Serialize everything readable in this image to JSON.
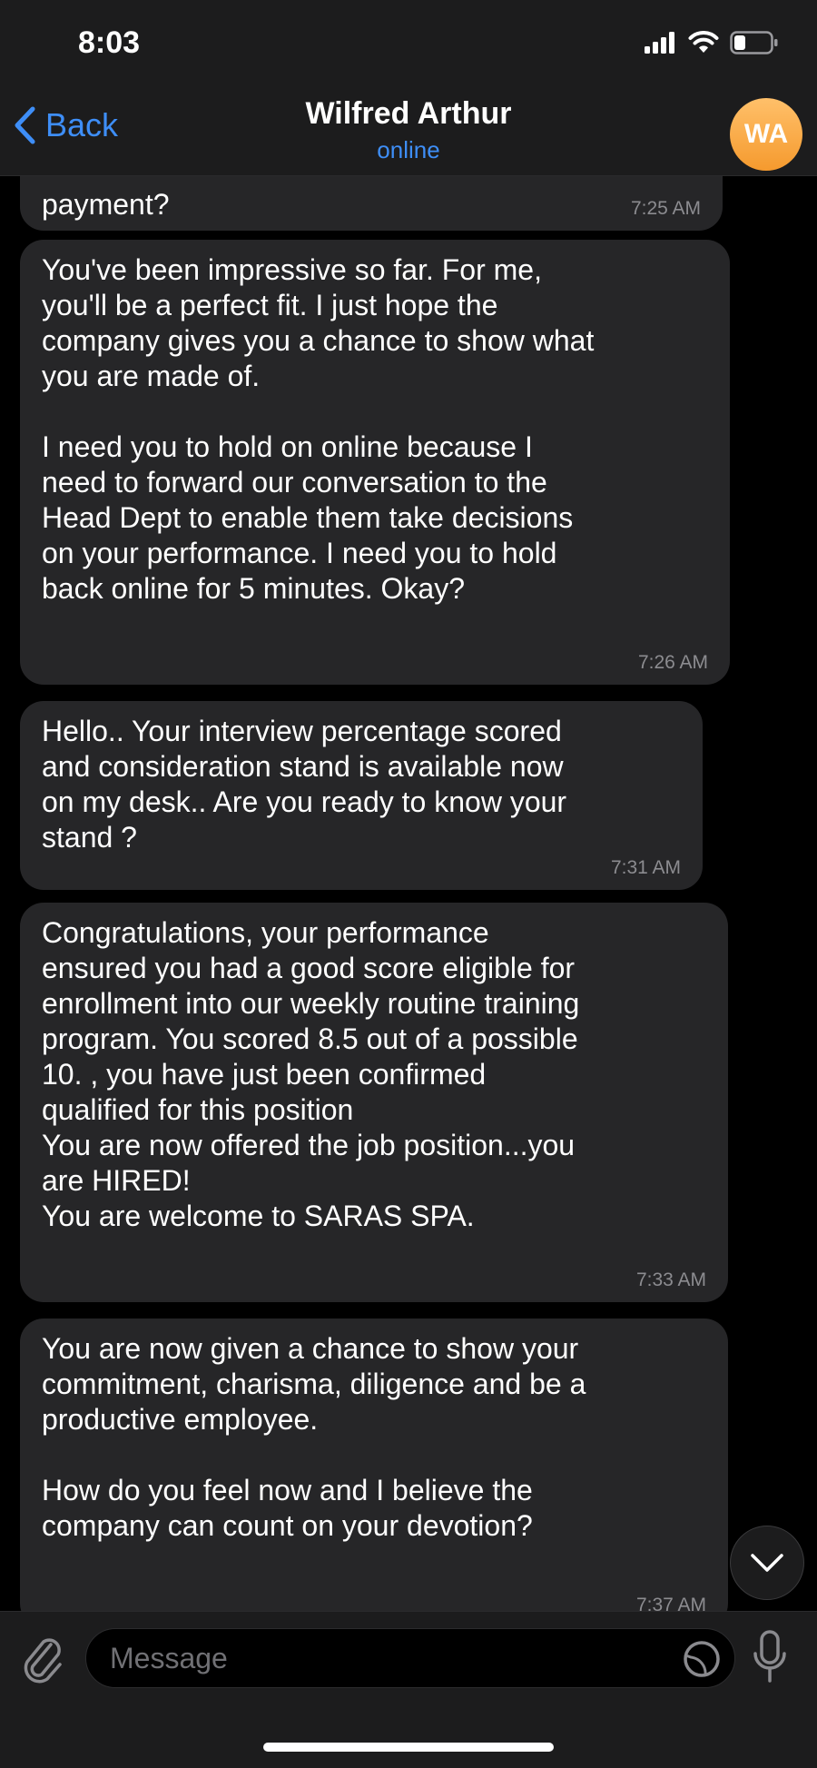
{
  "status": {
    "time": "8:03"
  },
  "header": {
    "back_label": "Back",
    "contact_name": "Wilfred Arthur",
    "contact_status": "online",
    "avatar_initials": "WA"
  },
  "messages": [
    {
      "text": "payment?",
      "time": "7:25 AM"
    },
    {
      "text": "You've been impressive so far. For me,\nyou'll be a perfect fit. I just hope the\ncompany gives you a chance to show what\nyou are made of.\n\nI need you to hold on online because I\nneed to forward our conversation to the\nHead Dept to enable them take decisions\non your performance. I need you to hold\nback online for 5 minutes. Okay?",
      "time": "7:26 AM"
    },
    {
      "text": "Hello.. Your interview percentage scored\nand consideration stand is available now\non my desk.. Are you ready to know your\nstand ?",
      "time": "7:31 AM"
    },
    {
      "text": "Congratulations, your performance\nensured you had a good score eligible for\nenrollment into our weekly routine training\nprogram. You scored 8.5 out of a possible\n10. , you have just been confirmed\nqualified for this position\nYou are now offered the job position...you\nare HIRED!\nYou are welcome to SARAS SPA.",
      "time": "7:33 AM"
    },
    {
      "text": "You are now given a chance to show your\ncommitment, charisma, diligence and be a\nproductive employee.\n\nHow do you feel now and I believe the\ncompany can count on your devotion?",
      "time": "7:37 AM"
    }
  ],
  "input": {
    "placeholder": "Message"
  },
  "icons": {
    "signal": "signal-icon",
    "wifi": "wifi-icon",
    "battery": "battery-icon",
    "back": "chevron-left-icon",
    "attach": "paperclip-icon",
    "sticker": "sticker-icon",
    "mic": "microphone-icon",
    "scroll": "chevron-down-icon"
  },
  "colors": {
    "accent": "#3e8ef7",
    "bubble": "#262628",
    "avatar": "#f5a03a"
  }
}
